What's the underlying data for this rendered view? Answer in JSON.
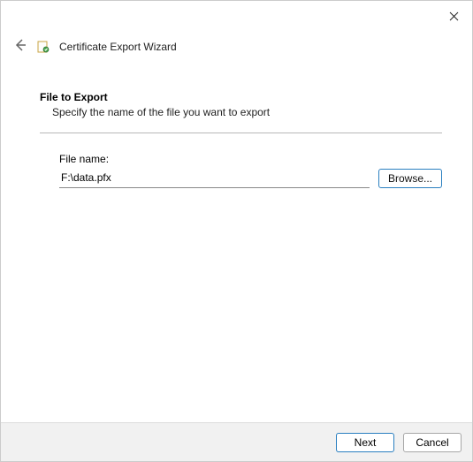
{
  "header": {
    "title": "Certificate Export Wizard"
  },
  "section": {
    "heading": "File to Export",
    "subheading": "Specify the name of the file you want to export"
  },
  "field": {
    "label": "File name:",
    "value": "F:\\data.pfx",
    "browse_label": "Browse..."
  },
  "footer": {
    "next_label": "Next",
    "cancel_label": "Cancel"
  }
}
